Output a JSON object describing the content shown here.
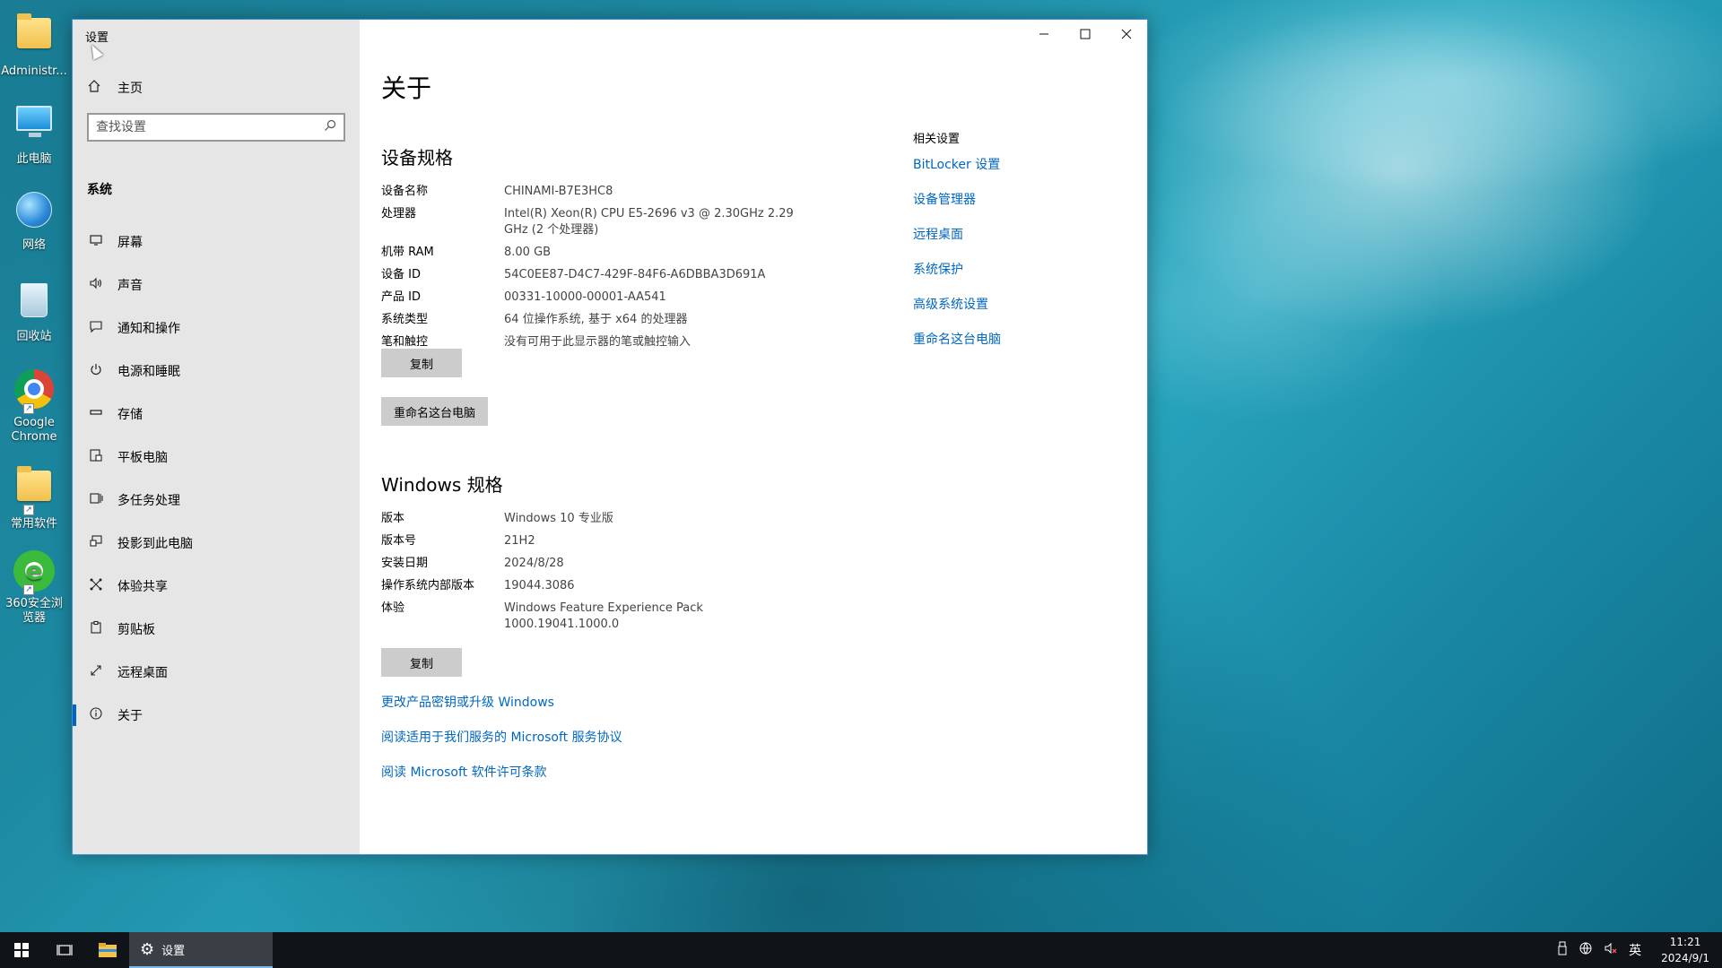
{
  "desktop": {
    "icons": [
      {
        "label": "Administr...",
        "icon": "user-folder-icon"
      },
      {
        "label": "此电脑",
        "icon": "this-pc-icon"
      },
      {
        "label": "网络",
        "icon": "network-icon"
      },
      {
        "label": "回收站",
        "icon": "recycle-bin-icon"
      },
      {
        "label": "Google Chrome",
        "icon": "chrome-icon"
      },
      {
        "label": "常用软件",
        "icon": "folder-icon"
      },
      {
        "label": "360安全浏览器",
        "icon": "360-browser-icon"
      }
    ]
  },
  "window": {
    "title": "设置",
    "controls": {
      "minimize": "—",
      "maximize": "☐",
      "close": "✕"
    }
  },
  "sidebar": {
    "home": "主页",
    "search_placeholder": "查找设置",
    "section": "系统",
    "items": [
      {
        "label": "屏幕",
        "icon": "display-icon"
      },
      {
        "label": "声音",
        "icon": "sound-icon"
      },
      {
        "label": "通知和操作",
        "icon": "notification-icon"
      },
      {
        "label": "电源和睡眠",
        "icon": "power-icon"
      },
      {
        "label": "存储",
        "icon": "storage-icon"
      },
      {
        "label": "平板电脑",
        "icon": "tablet-icon"
      },
      {
        "label": "多任务处理",
        "icon": "multitasking-icon"
      },
      {
        "label": "投影到此电脑",
        "icon": "project-icon"
      },
      {
        "label": "体验共享",
        "icon": "shared-experiences-icon"
      },
      {
        "label": "剪贴板",
        "icon": "clipboard-icon"
      },
      {
        "label": "远程桌面",
        "icon": "remote-desktop-icon"
      },
      {
        "label": "关于",
        "icon": "info-icon"
      }
    ],
    "active_index": 11
  },
  "main": {
    "title": "关于",
    "device_specs": {
      "heading": "设备规格",
      "rows": [
        {
          "k": "设备名称",
          "v": "CHINAMI-B7E3HC8"
        },
        {
          "k": "处理器",
          "v": "Intel(R) Xeon(R) CPU E5-2696 v3 @ 2.30GHz   2.29 GHz  (2 个处理器)"
        },
        {
          "k": "机带 RAM",
          "v": "8.00 GB"
        },
        {
          "k": "设备 ID",
          "v": "54C0EE87-D4C7-429F-84F6-A6DBBA3D691A"
        },
        {
          "k": "产品 ID",
          "v": "00331-10000-00001-AA541"
        },
        {
          "k": "系统类型",
          "v": "64 位操作系统, 基于 x64 的处理器"
        },
        {
          "k": "笔和触控",
          "v": "没有可用于此显示器的笔或触控输入"
        }
      ],
      "copy_label": "复制",
      "rename_label": "重命名这台电脑"
    },
    "windows_specs": {
      "heading": "Windows 规格",
      "rows": [
        {
          "k": "版本",
          "v": "Windows 10 专业版"
        },
        {
          "k": "版本号",
          "v": "21H2"
        },
        {
          "k": "安装日期",
          "v": "2024/8/28"
        },
        {
          "k": "操作系统内部版本",
          "v": "19044.3086"
        },
        {
          "k": "体验",
          "v": "Windows Feature Experience Pack 1000.19041.1000.0"
        }
      ],
      "copy_label": "复制"
    },
    "links": [
      "更改产品密钥或升级 Windows",
      "阅读适用于我们服务的 Microsoft 服务协议",
      "阅读 Microsoft 软件许可条款"
    ],
    "related": {
      "title": "相关设置",
      "links": [
        "BitLocker 设置",
        "设备管理器",
        "远程桌面",
        "系统保护",
        "高级系统设置",
        "重命名这台电脑"
      ]
    }
  },
  "taskbar": {
    "app_label": "设置",
    "tray": {
      "ime": "英",
      "time": "11:21",
      "date": "2024/9/1"
    }
  },
  "colors": {
    "accent": "#0067c0",
    "sidebar_bg": "#e6e6e6",
    "taskbar_bg": "#101418"
  }
}
